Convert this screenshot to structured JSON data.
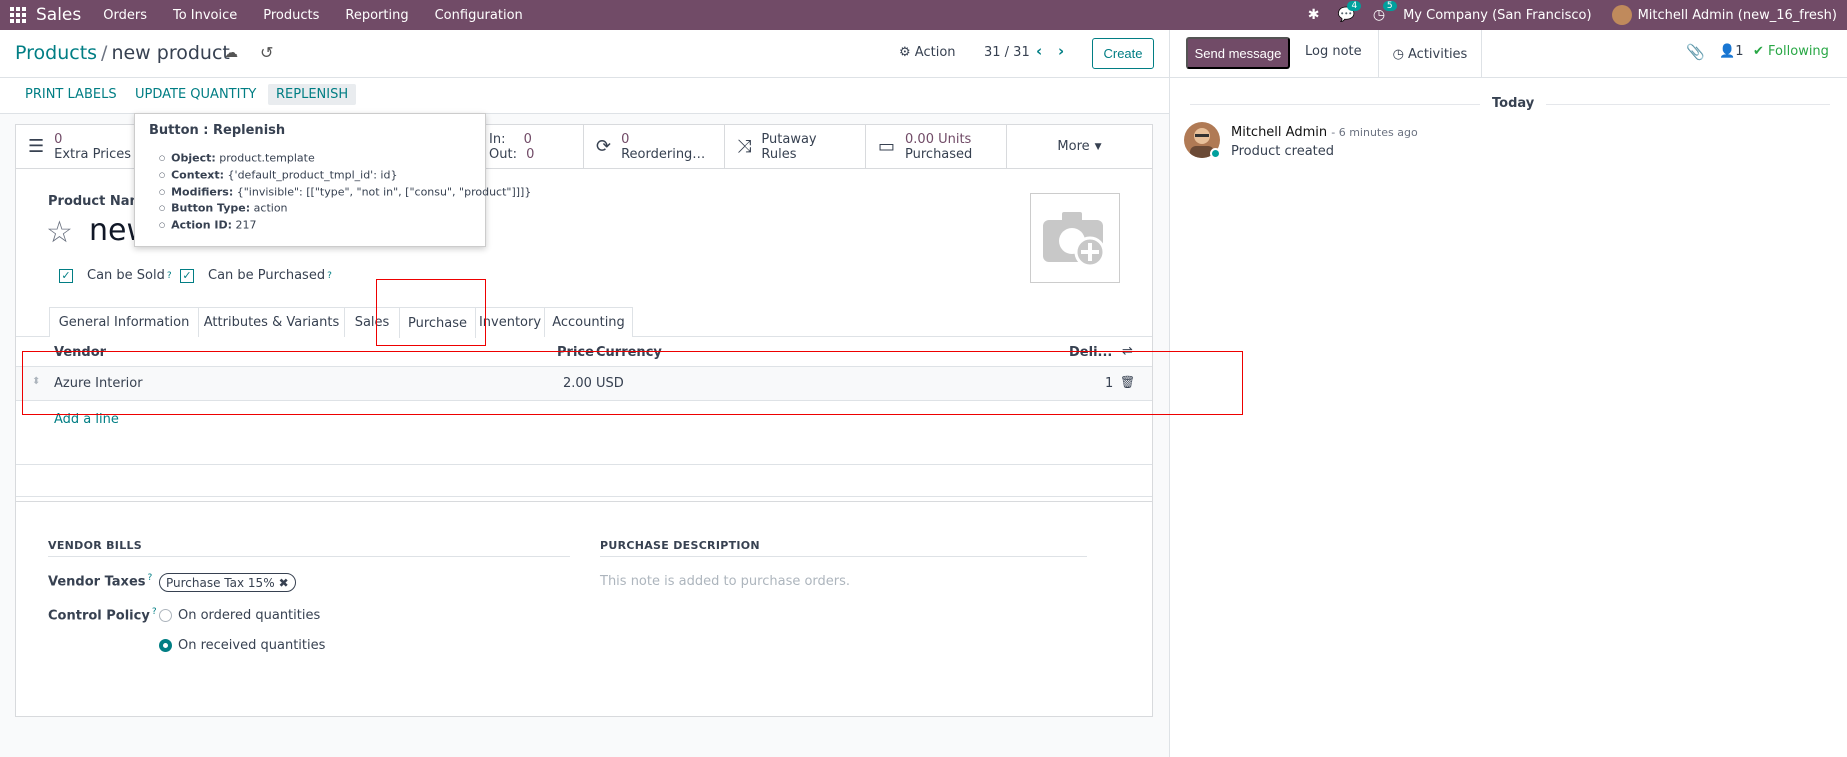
{
  "topnav": {
    "app": "Sales",
    "menu": [
      "Orders",
      "To Invoice",
      "Products",
      "Reporting",
      "Configuration"
    ],
    "messages_count": "4",
    "activities_count": "5",
    "company": "My Company (San Francisco)",
    "user": "Mitchell Admin (new_16_fresh)"
  },
  "control": {
    "breadcrumb_parent": "Products",
    "breadcrumb_sep": "/",
    "breadcrumb_current": "new product",
    "action_label": "Action",
    "pager": "31 / 31",
    "create_label": "Create"
  },
  "buttons": {
    "print_labels": "PRINT LABELS",
    "update_quantity": "UPDATE QUANTITY",
    "replenish": "REPLENISH"
  },
  "stats": {
    "extra_prices_value": "0",
    "extra_prices_label": "Extra Prices",
    "in_label": "In:",
    "in_value": "0",
    "out_label": "Out:",
    "out_value": "0",
    "reordering_value": "0",
    "reordering_label": "Reordering…",
    "putaway_1": "Putaway",
    "putaway_2": "Rules",
    "purchased_value": "0.00 Units",
    "purchased_label": "Purchased",
    "more_label": "More"
  },
  "product": {
    "name_label": "Product Name",
    "name_value": "new",
    "can_be_sold": "Can be Sold",
    "can_be_purchased": "Can be Purchased",
    "help_mark": "?"
  },
  "tabs": [
    "General Information",
    "Attributes & Variants",
    "Sales",
    "Purchase",
    "Inventory",
    "Accounting"
  ],
  "vendor_table": {
    "headers": [
      "Vendor",
      "Price",
      "Currency",
      "Deli..."
    ],
    "rows": [
      {
        "vendor": "Azure Interior",
        "price": "2.00",
        "currency": "USD",
        "delay": "1"
      }
    ],
    "add_line": "Add a line"
  },
  "vendor_bills": {
    "title": "VENDOR BILLS",
    "taxes_label": "Vendor Taxes",
    "tax_tag": "Purchase Tax 15%",
    "control_label": "Control Policy",
    "option_ordered": "On ordered quantities",
    "option_received": "On received quantities",
    "selected": "received"
  },
  "purchase_description": {
    "title": "PURCHASE DESCRIPTION",
    "placeholder": "This note is added to purchase orders."
  },
  "tooltip": {
    "title": "Button : Replenish",
    "lines": [
      {
        "key": "Object:",
        "value": "product.template"
      },
      {
        "key": "Context:",
        "value": "{'default_product_tmpl_id': id}"
      },
      {
        "key": "Modifiers:",
        "value": "{\"invisible\": [[\"type\", \"not in\", [\"consu\", \"product\"]]]}"
      },
      {
        "key": "Button Type:",
        "value": "action"
      },
      {
        "key": "Action ID:",
        "value": "217"
      }
    ]
  },
  "chatter": {
    "send_message": "Send message",
    "log_note": "Log note",
    "activities": "Activities",
    "followers_count": "1",
    "following": "Following",
    "date_separator": "Today",
    "message_author": "Mitchell Admin",
    "message_time": "- 6 minutes ago",
    "message_body": "Product created"
  },
  "colors": {
    "brand": "#714b67",
    "accent": "#017e84",
    "highlight_box": "#ee0000",
    "following": "#28a745"
  }
}
